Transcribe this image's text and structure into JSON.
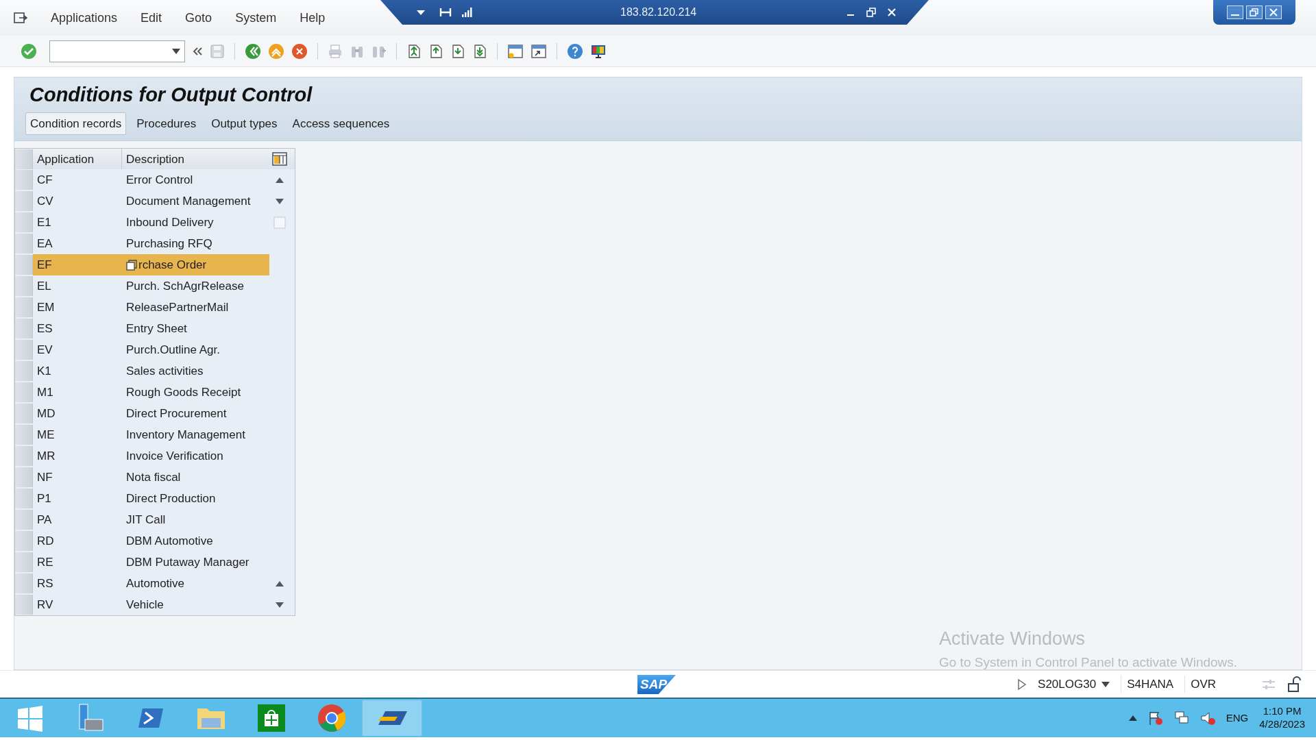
{
  "remote_bar": {
    "title": "183.82.120.214"
  },
  "menu": [
    "Applications",
    "Edit",
    "Goto",
    "System",
    "Help"
  ],
  "title": "Conditions for Output Control",
  "tabs": [
    {
      "label": "Condition records",
      "selected": true
    },
    {
      "label": "Procedures",
      "selected": false
    },
    {
      "label": "Output types",
      "selected": false
    },
    {
      "label": "Access sequences",
      "selected": false
    }
  ],
  "table": {
    "columns": [
      "Application",
      "Description"
    ],
    "rows": [
      {
        "application": "CF",
        "description": "Error Control",
        "selected": false
      },
      {
        "application": "CV",
        "description": "Document Management",
        "selected": false
      },
      {
        "application": "E1",
        "description": "Inbound Delivery",
        "selected": false
      },
      {
        "application": "EA",
        "description": "Purchasing RFQ",
        "selected": false
      },
      {
        "application": "EF",
        "description": "rchase Order",
        "selected": true
      },
      {
        "application": "EL",
        "description": "Purch. SchAgrRelease",
        "selected": false
      },
      {
        "application": "EM",
        "description": "ReleasePartnerMail",
        "selected": false
      },
      {
        "application": "ES",
        "description": "Entry Sheet",
        "selected": false
      },
      {
        "application": "EV",
        "description": "Purch.Outline Agr.",
        "selected": false
      },
      {
        "application": "K1",
        "description": "Sales activities",
        "selected": false
      },
      {
        "application": "M1",
        "description": "Rough Goods Receipt",
        "selected": false
      },
      {
        "application": "MD",
        "description": "Direct Procurement",
        "selected": false
      },
      {
        "application": "ME",
        "description": "Inventory Management",
        "selected": false
      },
      {
        "application": "MR",
        "description": "Invoice Verification",
        "selected": false
      },
      {
        "application": "NF",
        "description": "Nota fiscal",
        "selected": false
      },
      {
        "application": "P1",
        "description": "Direct Production",
        "selected": false
      },
      {
        "application": "PA",
        "description": "JIT Call",
        "selected": false
      },
      {
        "application": "RD",
        "description": "DBM Automotive",
        "selected": false
      },
      {
        "application": "RE",
        "description": "DBM Putaway Manager",
        "selected": false
      },
      {
        "application": "RS",
        "description": "Automotive",
        "selected": false
      },
      {
        "application": "RV",
        "description": "Vehicle",
        "selected": false
      }
    ]
  },
  "activation_notice": {
    "title": "Activate Windows",
    "text": "Go to System in Control Panel to activate Windows."
  },
  "status_bar": {
    "logo": "SAP",
    "system": "S20LOG30",
    "client": "S4HANA",
    "mode": "OVR"
  },
  "taskbar": {
    "language": "ENG",
    "time": "1:10 PM",
    "date": "4/28/2023"
  }
}
